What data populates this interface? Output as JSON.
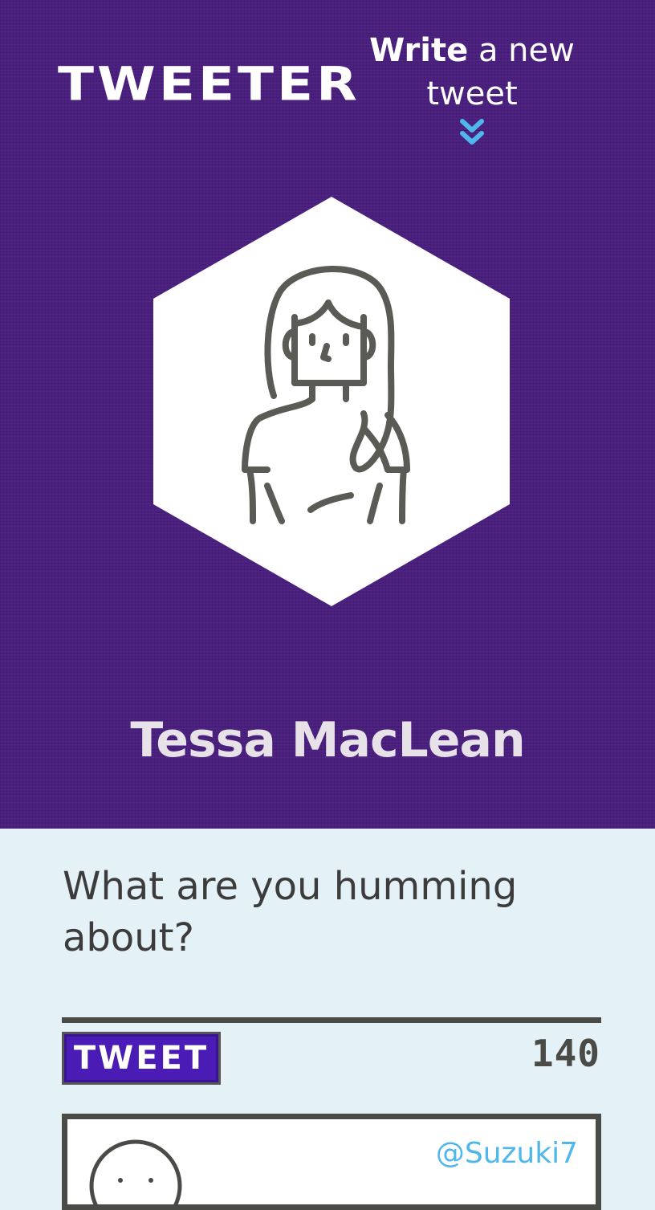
{
  "header": {
    "logo": "TWEETER",
    "write_link": {
      "bold": "Write",
      "rest_line1": " a new",
      "rest_line2": "tweet"
    }
  },
  "profile": {
    "name": "Tessa MacLean",
    "avatar_icon": "user-avatar-icon"
  },
  "compose": {
    "placeholder": "What are you humming about?",
    "value": "",
    "tweet_button_label": "TWEET",
    "char_count": "140"
  },
  "feed": {
    "tweets": [
      {
        "handle": "@Suzuki7",
        "avatar_icon": "user-avatar-icon"
      }
    ]
  },
  "colors": {
    "header_bg": "#4a1f7e",
    "page_bg": "#e4f1f7",
    "tweet_button_bg": "#4a1bb5",
    "chevron": "#4fb7ec",
    "handle": "#4fb7ec",
    "dark": "#4a4a47"
  }
}
